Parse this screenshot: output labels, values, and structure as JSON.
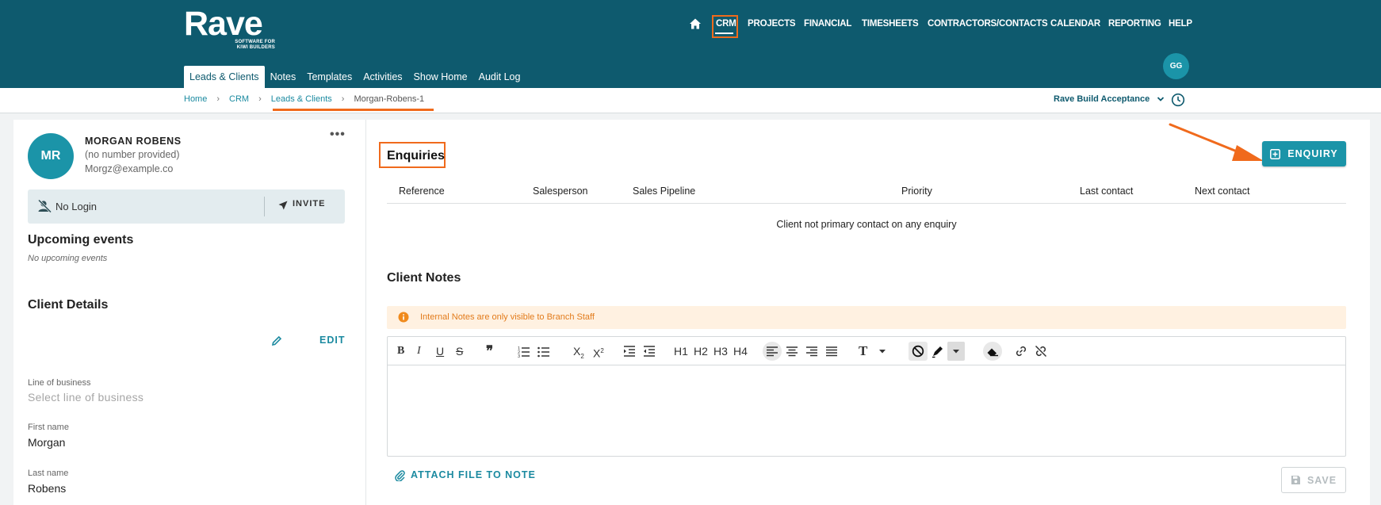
{
  "brand": {
    "logo_word": "Rave",
    "logo_tagline_line1": "SOFTWARE FOR",
    "logo_tagline_line2": "KIWI BUILDERS",
    "primary_color": "#0e5a6e",
    "accent_color": "#1b94a8",
    "highlight_color": "#f06a1c"
  },
  "main_nav": {
    "home_icon": "home-icon",
    "items": [
      {
        "label": "CRM",
        "active": true
      },
      {
        "label": "PROJECTS"
      },
      {
        "label": "FINANCIAL"
      },
      {
        "label": "TIMESHEETS"
      },
      {
        "label": "CONTRACTORS/CONTACTS"
      },
      {
        "label": "CALENDAR"
      },
      {
        "label": "REPORTING"
      },
      {
        "label": "HELP"
      }
    ]
  },
  "sub_nav": {
    "tabs": [
      {
        "label": "Leads & Clients",
        "active": true
      },
      {
        "label": "Notes"
      },
      {
        "label": "Templates"
      },
      {
        "label": "Activities"
      },
      {
        "label": "Show Home"
      },
      {
        "label": "Audit Log"
      }
    ]
  },
  "user": {
    "initials": "GG"
  },
  "breadcrumb": {
    "items": [
      "Home",
      "CRM",
      "Leads & Clients",
      "Morgan-Robens-1"
    ]
  },
  "workspace": {
    "label": "Rave Build Acceptance"
  },
  "client": {
    "initials": "MR",
    "name": "MORGAN ROBENS",
    "phone": "(no number provided)",
    "email": "Morgz@example.co",
    "login_status": "No Login",
    "invite_label": "INVITE"
  },
  "upcoming": {
    "title": "Upcoming events",
    "empty": "No upcoming events"
  },
  "client_details": {
    "title": "Client Details",
    "edit_label": "EDIT",
    "fields": [
      {
        "label": "Line of business",
        "placeholder": "Select line of business"
      },
      {
        "label": "First name",
        "value": "Morgan"
      },
      {
        "label": "Last name",
        "value": "Robens"
      }
    ]
  },
  "enquiries": {
    "title": "Enquiries",
    "add_button": "ENQUIRY",
    "columns": [
      "Reference",
      "Salesperson",
      "Sales Pipeline",
      "Priority",
      "Last contact",
      "Next contact"
    ],
    "empty_message": "Client not primary contact on any enquiry"
  },
  "client_notes": {
    "title": "Client Notes",
    "alert": "Internal Notes are only visible to Branch Staff",
    "toolbar": {
      "h1": "H1",
      "h2": "H2",
      "h3": "H3",
      "h4": "H4"
    },
    "attach_label": "ATTACH FILE TO NOTE",
    "save_label": "SAVE"
  }
}
